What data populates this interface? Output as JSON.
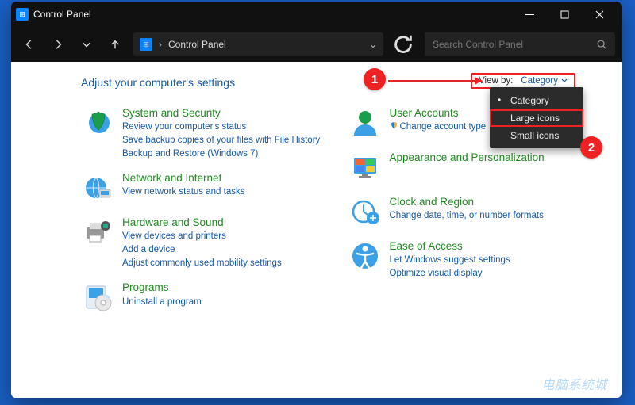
{
  "titlebar": {
    "app_title": "Control Panel"
  },
  "address": {
    "crumb": "Control Panel"
  },
  "search": {
    "placeholder": "Search Control Panel"
  },
  "heading": "Adjust your computer's settings",
  "viewby": {
    "label": "View by:",
    "value": "Category",
    "options": [
      "Category",
      "Large icons",
      "Small icons"
    ],
    "selected_index": 0,
    "highlighted_index": 1
  },
  "annotations": {
    "badge1": "1",
    "badge2": "2"
  },
  "categories_left": [
    {
      "title": "System and Security",
      "links": [
        "Review your computer's status",
        "Save backup copies of your files with File History",
        "Backup and Restore (Windows 7)"
      ],
      "icon": "shield"
    },
    {
      "title": "Network and Internet",
      "links": [
        "View network status and tasks"
      ],
      "icon": "globe"
    },
    {
      "title": "Hardware and Sound",
      "links": [
        "View devices and printers",
        "Add a device",
        "Adjust commonly used mobility settings"
      ],
      "icon": "printer"
    },
    {
      "title": "Programs",
      "links": [
        "Uninstall a program"
      ],
      "icon": "disc"
    }
  ],
  "categories_right": [
    {
      "title": "User Accounts",
      "links": [
        "Change account type"
      ],
      "icon": "user",
      "link_shield": true
    },
    {
      "title": "Appearance and Personalization",
      "links": [],
      "icon": "desktop"
    },
    {
      "title": "Clock and Region",
      "links": [
        "Change date, time, or number formats"
      ],
      "icon": "clock"
    },
    {
      "title": "Ease of Access",
      "links": [
        "Let Windows suggest settings",
        "Optimize visual display"
      ],
      "icon": "access"
    }
  ],
  "watermark": "电脑系统城"
}
